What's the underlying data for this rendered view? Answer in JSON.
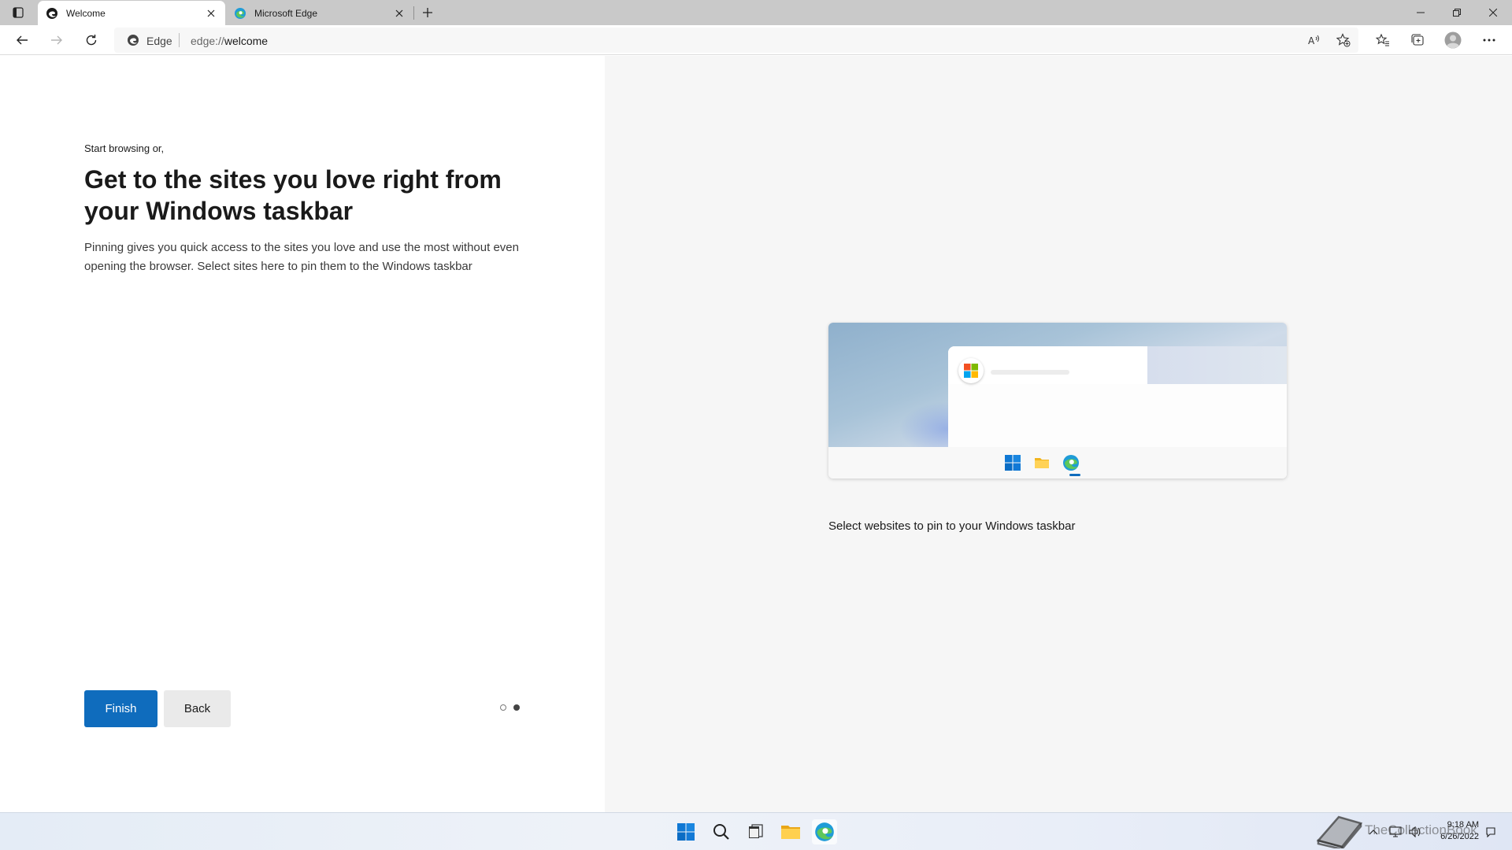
{
  "tabs": [
    {
      "title": "Welcome",
      "active": true
    },
    {
      "title": "Microsoft Edge",
      "active": false
    }
  ],
  "addressbar": {
    "site_label": "Edge",
    "url_scheme": "edge://",
    "url_path": "welcome"
  },
  "content": {
    "kicker": "Start browsing or,",
    "headline": "Get to the sites you love right from your Windows taskbar",
    "description": "Pinning gives you quick access to the sites you love and use the most without even opening the browser. Select sites here to pin them to the Windows taskbar",
    "finish_label": "Finish",
    "back_label": "Back",
    "step_current": 2,
    "step_total": 2,
    "caption": "Select websites to pin to your Windows taskbar"
  },
  "taskbar": {
    "time": "9:18 AM",
    "date": "6/26/2022"
  },
  "watermark": {
    "text": "TheCollectionBook"
  },
  "colors": {
    "accent": "#0f6cbd",
    "right_pane_bg": "#f6f6f6",
    "tabstrip_bg": "#c9c9c9"
  },
  "icons": {
    "tab_actions": "tab-actions-icon",
    "new_tab": "plus-icon",
    "back": "arrow-left-icon",
    "forward": "arrow-right-icon",
    "refresh": "refresh-icon",
    "read_aloud": "read-aloud-icon",
    "add_favorite": "star-plus-icon",
    "favorites": "favorites-icon",
    "collections": "collections-icon",
    "profile": "profile-icon",
    "more": "more-icon"
  }
}
